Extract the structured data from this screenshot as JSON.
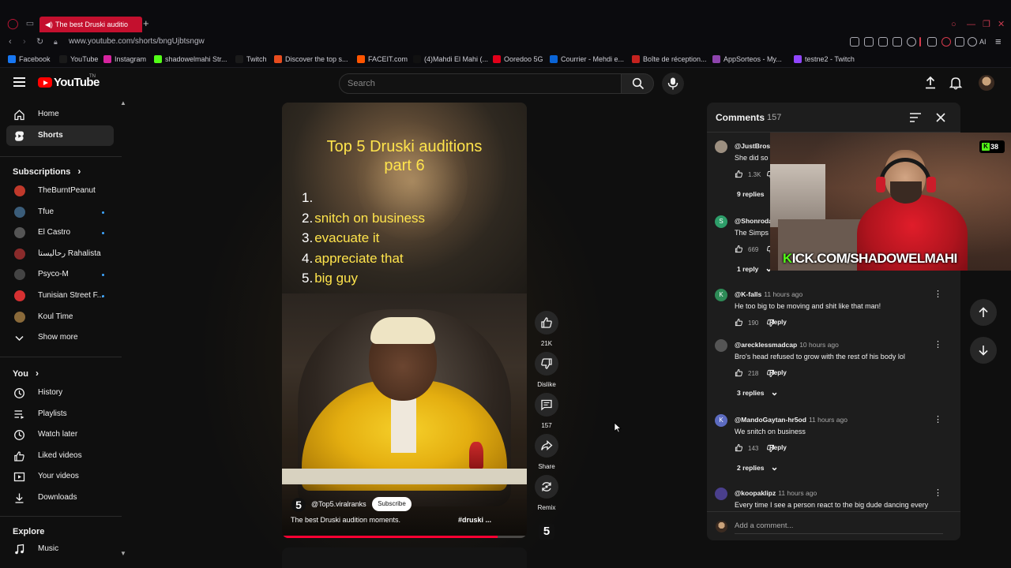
{
  "browser": {
    "tab_title": "The best Druski auditio",
    "url": "www.youtube.com/shorts/bngUjbtsngw",
    "ai_label": "AI",
    "bookmarks": [
      {
        "label": "Facebook",
        "color": "#1877f2"
      },
      {
        "label": "YouTube",
        "color": "#1a1a1a"
      },
      {
        "label": "Instagram",
        "color": "#d6249f"
      },
      {
        "label": "shadowelmahi Str...",
        "color": "#53fc18"
      },
      {
        "label": "Twitch",
        "color": "#1a1a1a"
      },
      {
        "label": "Discover the top s...",
        "color": "#e84c1e"
      },
      {
        "label": "FACEIT.com",
        "color": "#ff5500"
      },
      {
        "label": "(4)Mahdi El Mahi (...",
        "color": "#111111"
      },
      {
        "label": "Ooredoo 5G",
        "color": "#e2001a"
      },
      {
        "label": "Courrier - Mehdi e...",
        "color": "#0a64d6"
      },
      {
        "label": "Boîte de réception...",
        "color": "#c5221f"
      },
      {
        "label": "AppSorteos - My...",
        "color": "#8e44ad"
      },
      {
        "label": "testne2 - Twitch",
        "color": "#9146ff"
      }
    ]
  },
  "youtube": {
    "logo_text": "YouTube",
    "logo_suffix": "TN",
    "search_placeholder": "Search"
  },
  "sidebar": {
    "main": [
      {
        "label": "Home",
        "icon": "home-icon",
        "active": false
      },
      {
        "label": "Shorts",
        "icon": "shorts-icon",
        "active": true
      }
    ],
    "subscriptions_title": "Subscriptions",
    "subscriptions": [
      {
        "label": "TheBurntPeanut",
        "color": "#c0392b"
      },
      {
        "label": "Tfue",
        "color": "#3b5d7a"
      },
      {
        "label": "El Castro",
        "color": "#555555"
      },
      {
        "label": "رحالیستا Rahalista",
        "color": "#8a2b2b"
      },
      {
        "label": "Psyco-M",
        "color": "#444444"
      },
      {
        "label": "Tunisian Street F...",
        "color": "#d63031"
      },
      {
        "label": "Koul Time",
        "color": "#8a6a3a"
      }
    ],
    "show_more": "Show more",
    "you_title": "You",
    "you_items": [
      {
        "label": "History",
        "icon": "history-icon"
      },
      {
        "label": "Playlists",
        "icon": "playlists-icon"
      },
      {
        "label": "Watch later",
        "icon": "watch-later-icon"
      },
      {
        "label": "Liked videos",
        "icon": "liked-videos-icon"
      },
      {
        "label": "Your videos",
        "icon": "your-videos-icon"
      },
      {
        "label": "Downloads",
        "icon": "downloads-icon"
      }
    ],
    "explore_title": "Explore",
    "explore_items": [
      {
        "label": "Music",
        "icon": "music-icon"
      }
    ]
  },
  "short": {
    "overlay_title_line1": "Top 5 Druski auditions",
    "overlay_title_line2": "part 6",
    "overlay_list": [
      {
        "num": "1.",
        "text": ""
      },
      {
        "num": "2.",
        "text": "snitch on business"
      },
      {
        "num": "3.",
        "text": "evacuate it"
      },
      {
        "num": "4.",
        "text": "appreciate that"
      },
      {
        "num": "5.",
        "text": "big guy"
      }
    ],
    "channel_badge": "5",
    "channel": "@Top5.viralranks",
    "subscribe": "Subscribe",
    "caption": "The best Druski audition moments.",
    "hashtag": "#druski ...",
    "progress": 0.88,
    "actions": {
      "like_count": "21K",
      "dislike": "Dislike",
      "comments_count": "157",
      "share": "Share",
      "remix": "Remix",
      "remix_thumb": "5"
    }
  },
  "comments": {
    "title": "Comments",
    "count": "157",
    "items": [
      {
        "author": "@JustBros",
        "time": "",
        "text": "She did so",
        "likes": "1.3K",
        "avatar_color": "#9c8f80",
        "avatar_letter": "",
        "replies": "9 replies"
      },
      {
        "author": "@Shonroda",
        "time": "",
        "text": "The Simps",
        "likes": "669",
        "avatar_color": "#2e9e6a",
        "avatar_letter": "S",
        "replies": "1 reply"
      },
      {
        "author": "@K-falls",
        "time": "11 hours ago",
        "text": "He too big to be moving and shit like that man!",
        "likes": "190",
        "avatar_color": "#2e8b57",
        "avatar_letter": "K",
        "replies": ""
      },
      {
        "author": "@arecklessmadcap",
        "time": "10 hours ago",
        "text": "Bro's head refused to grow with the rest of his body lol",
        "likes": "218",
        "avatar_color": "#555555",
        "avatar_letter": "",
        "replies": "3 replies"
      },
      {
        "author": "@MandoGaytan-hr5od",
        "time": "11 hours ago",
        "text": "We snitch on business",
        "likes": "143",
        "avatar_color": "#5c6bc0",
        "avatar_letter": "K",
        "replies": "2 replies"
      },
      {
        "author": "@koopaklipz",
        "time": "11 hours ago",
        "text": "Every time I see a person react to the big dude dancing every",
        "likes": "",
        "avatar_color": "#4a3f8c",
        "avatar_letter": "",
        "replies": ""
      }
    ],
    "reply_label": "Reply",
    "add_placeholder": "Add a comment..."
  },
  "stream_overlay": {
    "viewer_count": "38",
    "kick_prefix": "K",
    "kick_url": "ICK.COM/SHADOWELMAHI"
  }
}
